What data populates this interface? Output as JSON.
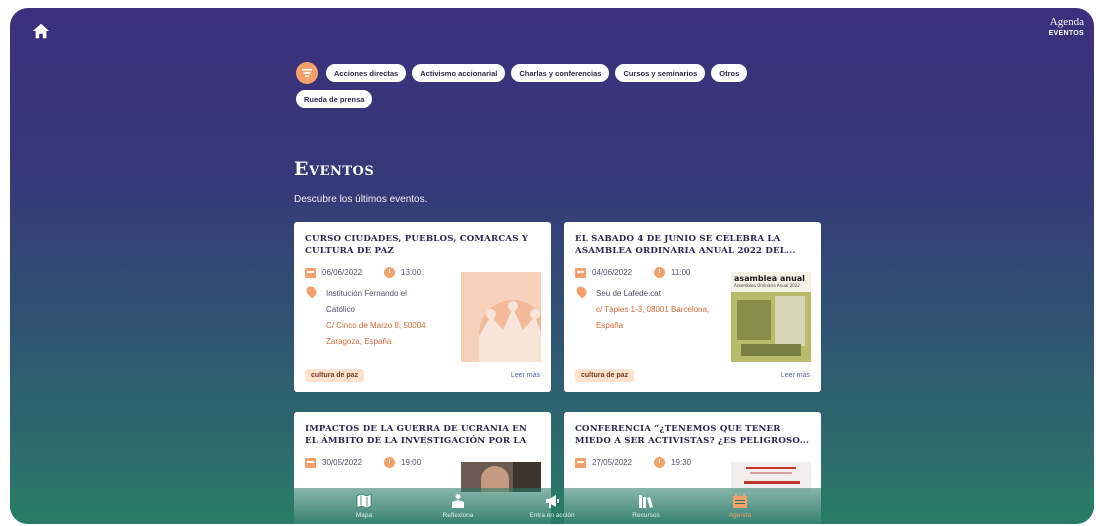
{
  "header": {
    "title": "Agenda",
    "subtitle": "Eventos"
  },
  "filters": {
    "row1": [
      "Acciones directas",
      "Activismo accionarial",
      "Charlas y conferencias",
      "Cursos y seminarios",
      "Otros"
    ],
    "row2": [
      "Rueda de prensa"
    ]
  },
  "section": {
    "title": "Eventos",
    "description": "Descubre los últimos eventos."
  },
  "events": [
    {
      "title": "Curso Ciudades, Pueblos, Comarcas y Cultura de Paz",
      "date": "06/06/2022",
      "time": "13:00",
      "venue_lines": [
        "Institución Fernando el",
        "Católico"
      ],
      "address_lines": [
        "C/ Cinco de Marzo 8, 50004",
        "Zaragoza, España"
      ],
      "tag": "cultura de paz",
      "more": "Leer más"
    },
    {
      "title": "El sábado 4 de junio se celebra la Asamblea Ordinaria Anual 2022 del...",
      "date": "04/06/2022",
      "time": "11:00",
      "venue_lines": [
        "Seu de Lafede.cat"
      ],
      "address_lines": [
        "c/ Tàpies 1-3, 08001 Barcelona,",
        "España"
      ],
      "tag": "cultura de paz",
      "more": "Leer más",
      "thumb_text": [
        "asamblea anual",
        "Assemblea Ordinària Anual 2022"
      ]
    },
    {
      "title": "Impactos de la guerra de Ucrania en el ámbito de la investigación por la paz",
      "date": "30/05/2022",
      "time": "19:00"
    },
    {
      "title": "Conferencia “¿Tenemos que tener miedo a ser activistas? ¿Es peligroso...",
      "date": "27/05/2022",
      "time": "19:30"
    }
  ],
  "nav": [
    {
      "label": "Mapa",
      "icon": "map-icon"
    },
    {
      "label": "Reflexiona",
      "icon": "reflect-icon"
    },
    {
      "label": "Entra en acción",
      "icon": "megaphone-icon"
    },
    {
      "label": "Recursos",
      "icon": "books-icon"
    },
    {
      "label": "Agenda",
      "icon": "calendar-icon",
      "active": true
    }
  ],
  "colors": {
    "accent": "#f4a06b",
    "title": "#2b2650",
    "address": "#d46a3a",
    "link": "#5a5fb0"
  }
}
